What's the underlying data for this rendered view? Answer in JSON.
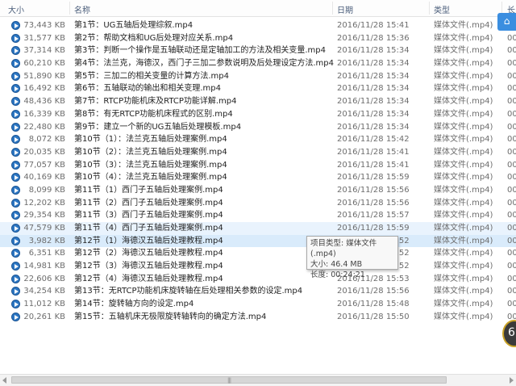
{
  "header": {
    "col_size": "大小",
    "col_name": "名称",
    "col_date": "日期",
    "col_type": "类型",
    "col_extra": "长"
  },
  "files": [
    {
      "size": "73,443 KB",
      "name": "第1节：UG五轴后处理综叙.mp4",
      "date": "2016/11/28 15:41",
      "type": "媒体文件(.mp4)",
      "extra": "00"
    },
    {
      "size": "31,577 KB",
      "name": "第2节：帮助文档和UG后处理对应关系.mp4",
      "date": "2016/11/28 15:36",
      "type": "媒体文件(.mp4)",
      "extra": "00"
    },
    {
      "size": "37,314 KB",
      "name": "第3节：判断一个操作是五轴联动还是定轴加工的方法及相关变量.mp4",
      "date": "2016/11/28 15:34",
      "type": "媒体文件(.mp4)",
      "extra": "00"
    },
    {
      "size": "60,210 KB",
      "name": "第4节：法兰克，海德汉，西门子三加二参数说明及后处理设定方法.mp4",
      "date": "2016/11/28 15:34",
      "type": "媒体文件(.mp4)",
      "extra": "00"
    },
    {
      "size": "51,890 KB",
      "name": "第5节：三加二的相关变量的计算方法.mp4",
      "date": "2016/11/28 15:34",
      "type": "媒体文件(.mp4)",
      "extra": "00"
    },
    {
      "size": "16,492 KB",
      "name": "第6节：五轴联动的输出和相关变理.mp4",
      "date": "2016/11/28 15:34",
      "type": "媒体文件(.mp4)",
      "extra": "00"
    },
    {
      "size": "48,436 KB",
      "name": "第7节：RTCP功能机床及RTCP功能详解.mp4",
      "date": "2016/11/28 15:34",
      "type": "媒体文件(.mp4)",
      "extra": "00"
    },
    {
      "size": "16,339 KB",
      "name": "第8节：有无RTCP功能机床程式的区别.mp4",
      "date": "2016/11/28 15:34",
      "type": "媒体文件(.mp4)",
      "extra": "00"
    },
    {
      "size": "22,480 KB",
      "name": "第9节：建立一个新的UG五轴后处理模板.mp4",
      "date": "2016/11/28 15:34",
      "type": "媒体文件(.mp4)",
      "extra": "00"
    },
    {
      "size": "8,072 KB",
      "name": "第10节（1）：法兰克五轴后处理案例.mp4",
      "date": "2016/11/28 15:42",
      "type": "媒体文件(.mp4)",
      "extra": "00"
    },
    {
      "size": "20,035 KB",
      "name": "第10节（2）：法兰克五轴后处理案例.mp4",
      "date": "2016/11/28 15:41",
      "type": "媒体文件(.mp4)",
      "extra": "00"
    },
    {
      "size": "77,057 KB",
      "name": "第10节（3）：法兰克五轴后处理案例.mp4",
      "date": "2016/11/28 15:41",
      "type": "媒体文件(.mp4)",
      "extra": "00"
    },
    {
      "size": "40,169 KB",
      "name": "第10节（4）：法兰克五轴后处理案例.mp4",
      "date": "2016/11/28 15:59",
      "type": "媒体文件(.mp4)",
      "extra": "00"
    },
    {
      "size": "8,099 KB",
      "name": "第11节（1）西门子五轴后处理案例.mp4",
      "date": "2016/11/28 15:56",
      "type": "媒体文件(.mp4)",
      "extra": "00"
    },
    {
      "size": "12,202 KB",
      "name": "第11节（2）西门子五轴后处理案例.mp4",
      "date": "2016/11/28 15:56",
      "type": "媒体文件(.mp4)",
      "extra": "00"
    },
    {
      "size": "29,354 KB",
      "name": "第11节（3）西门子五轴后处理案例.mp4",
      "date": "2016/11/28 15:57",
      "type": "媒体文件(.mp4)",
      "extra": "00"
    },
    {
      "size": "47,579 KB",
      "name": "第11节（4）西门子五轴后处理案例.mp4",
      "date": "2016/11/28 15:59",
      "type": "媒体文件(.mp4)",
      "extra": "00",
      "state": "hover"
    },
    {
      "size": "3,982 KB",
      "name": "第12节（1）海德汉五轴后处理教程.mp4",
      "date": "2016/11/28 15:52",
      "type": "媒体文件(.mp4)",
      "extra": "00",
      "state": "sel"
    },
    {
      "size": "6,351 KB",
      "name": "第12节（2）海德汉五轴后处理教程.mp4",
      "date": "2016/11/28 15:52",
      "type": "媒体文件(.mp4)",
      "extra": "00"
    },
    {
      "size": "14,981 KB",
      "name": "第12节（3）海德汉五轴后处理教程.mp4",
      "date": "2016/11/28 15:52",
      "type": "媒体文件(.mp4)",
      "extra": "00"
    },
    {
      "size": "22,606 KB",
      "name": "第12节（4）海德汉五轴后处理教程.mp4",
      "date": "2016/11/28 15:53",
      "type": "媒体文件(.mp4)",
      "extra": "00"
    },
    {
      "size": "34,254 KB",
      "name": "第13节：无RTCP功能机床旋转轴在后处理相关参数的设定.mp4",
      "date": "2016/11/28 15:56",
      "type": "媒体文件(.mp4)",
      "extra": "00"
    },
    {
      "size": "11,012 KB",
      "name": "第14节：旋转轴方向的设定.mp4",
      "date": "2016/11/28 15:48",
      "type": "媒体文件(.mp4)",
      "extra": "00"
    },
    {
      "size": "20,261 KB",
      "name": "第15节：五轴机床无极限旋转轴转向的确定方法.mp4",
      "date": "2016/11/28 15:50",
      "type": "媒体文件(.mp4)",
      "extra": "00"
    }
  ],
  "tooltip": {
    "line1": "项目类型: 媒体文件(.mp4)",
    "line2": "大小: 46.4 MB",
    "line3": "长度: 00:24:21"
  },
  "floating": {
    "share_glyph": "⌂",
    "circle_text": "6"
  },
  "scrollbar": {
    "grip": "|||"
  },
  "colors": {
    "selected_row": "#d9ebfb",
    "hover_row": "#e9f3fd",
    "icon": "#2c76c2"
  }
}
